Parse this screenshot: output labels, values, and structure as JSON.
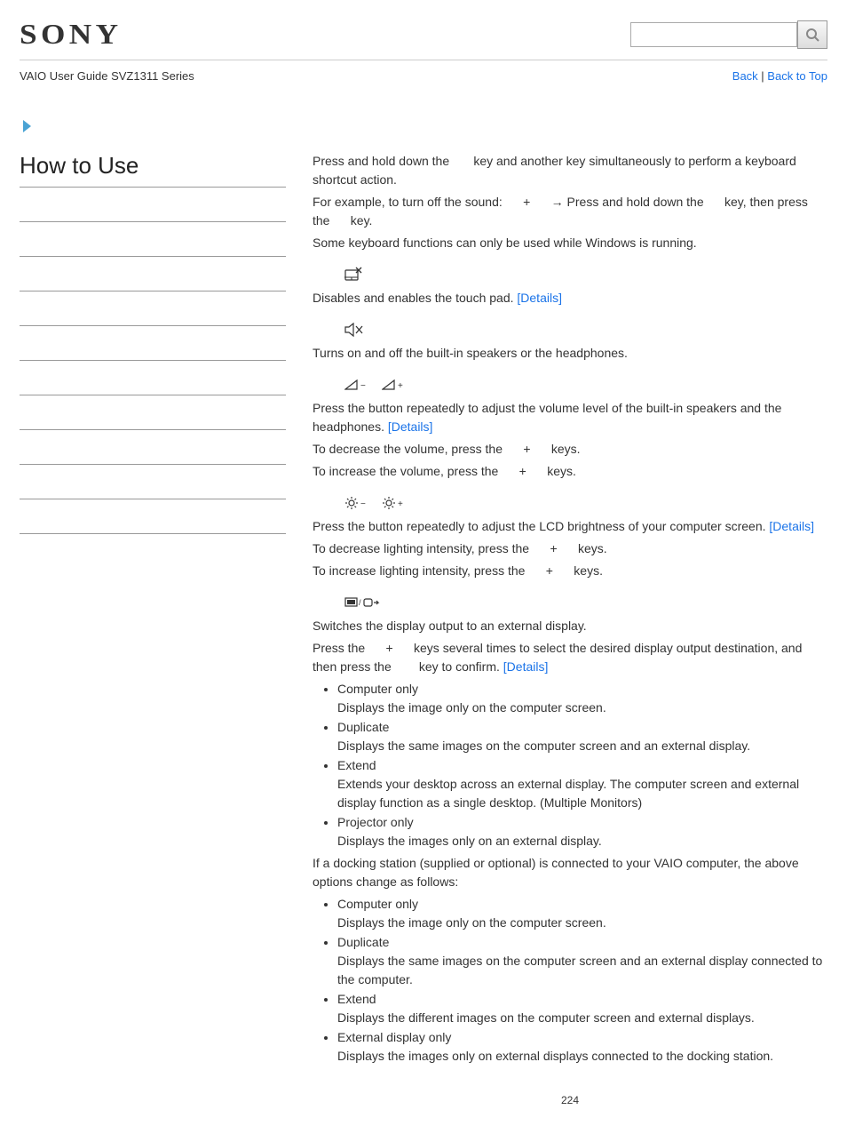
{
  "header": {
    "logo": "SONY",
    "guide": "VAIO User Guide SVZ1311 Series",
    "back": "Back",
    "sep": " | ",
    "back_to_top": "Back to Top"
  },
  "sidebar": {
    "title": "How to Use"
  },
  "main": {
    "intro1a": "Press and hold down the ",
    "intro1b": " key and another key simultaneously to perform a keyboard shortcut action.",
    "intro2a": "For example, to turn off the sound: ",
    "intro2b": " + ",
    "intro2c": " → Press and hold down the ",
    "intro2d": " key, then press the ",
    "intro2e": " key.",
    "intro3": "Some keyboard functions can only be used while Windows is running.",
    "touchpad": {
      "text": "Disables and enables the touch pad. ",
      "details": "[Details]"
    },
    "speaker": {
      "text": "Turns on and off the built-in speakers or the headphones."
    },
    "volume": {
      "line1a": "Press the button repeatedly to adjust the volume level of the built-in speakers and the headphones. ",
      "details": "[Details]",
      "line2a": "To decrease the volume, press the ",
      "line2b": " + ",
      "line2c": " keys.",
      "line3a": "To increase the volume, press the ",
      "line3b": " + ",
      "line3c": " keys."
    },
    "brightness": {
      "line1a": "Press the button repeatedly to adjust the LCD brightness of your computer screen. ",
      "details": "[Details]",
      "line2a": "To decrease lighting intensity, press the ",
      "line2b": " + ",
      "line2c": " keys.",
      "line3a": "To increase lighting intensity, press the ",
      "line3b": " + ",
      "line3c": " keys."
    },
    "display": {
      "line1": "Switches the display output to an external display.",
      "line2a": "Press the ",
      "line2b": " + ",
      "line2c": " keys several times to select the desired display output destination, and then press the ",
      "line2d": " key to confirm. ",
      "details": "[Details]",
      "list1": [
        {
          "t": "Computer only",
          "d": "Displays the image only on the computer screen."
        },
        {
          "t": "Duplicate",
          "d": "Displays the same images on the computer screen and an external display."
        },
        {
          "t": "Extend",
          "d": "Extends your desktop across an external display. The computer screen and external display function as a single desktop. (Multiple Monitors)"
        },
        {
          "t": "Projector only",
          "d": "Displays the images only on an external display."
        }
      ],
      "dock_intro": "If a docking station (supplied or optional) is connected to your VAIO computer, the above options change as follows:",
      "list2": [
        {
          "t": "Computer only",
          "d": "Displays the image only on the computer screen."
        },
        {
          "t": "Duplicate",
          "d": "Displays the same images on the computer screen and an external display connected to the computer."
        },
        {
          "t": "Extend",
          "d": "Displays the different images on the computer screen and external displays."
        },
        {
          "t": "External display only",
          "d": "Displays the images only on external displays connected to the docking station."
        }
      ]
    }
  },
  "page_number": "224"
}
